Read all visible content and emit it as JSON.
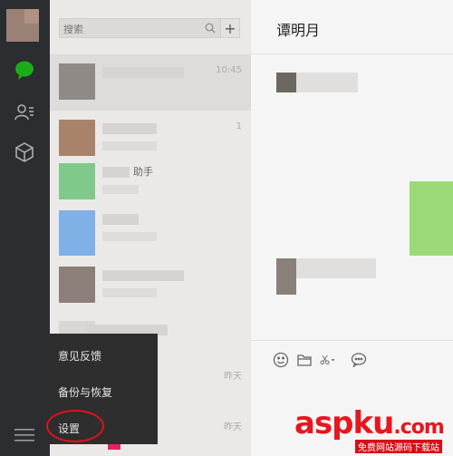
{
  "search": {
    "placeholder": "搜索"
  },
  "add_button": {
    "label": "+"
  },
  "chat_list": {
    "times": [
      "10:45",
      "1",
      "",
      "",
      "",
      "昨天",
      "昨天"
    ],
    "name_fragment": "助手"
  },
  "popup_menu": {
    "items": [
      "意见反馈",
      "备份与恢复",
      "设置"
    ]
  },
  "chat": {
    "title": "谭明月"
  },
  "watermark": {
    "main": "aspku",
    "tld": ".com",
    "sub": "免费网站源码下载站"
  },
  "colors": {
    "nav_bg": "#2b2d30",
    "accent_green": "#1aad19",
    "highlight_red": "#e0131b"
  }
}
